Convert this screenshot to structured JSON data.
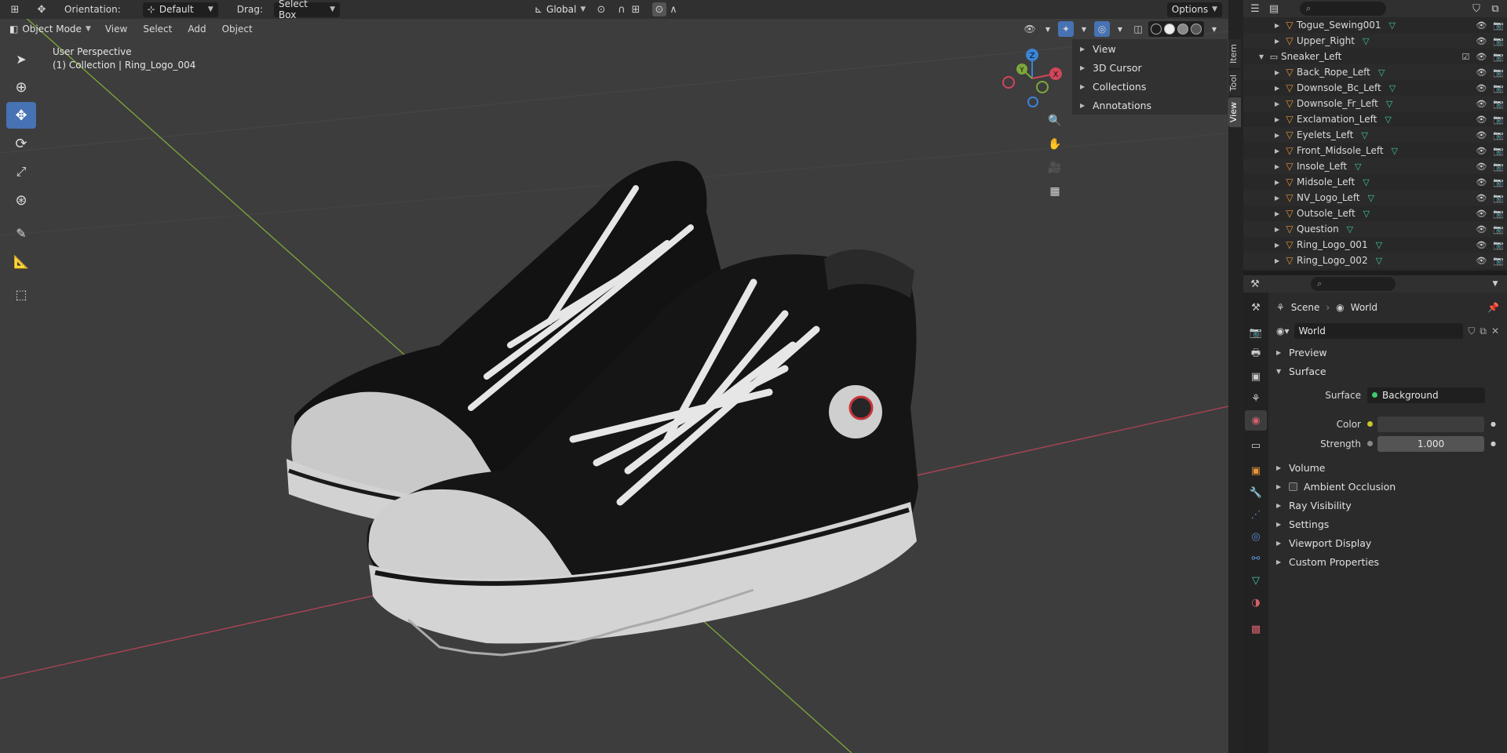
{
  "header": {
    "orientation_label": "Orientation:",
    "orientation_value": "Default",
    "drag_label": "Drag:",
    "drag_value": "Select Box",
    "transform_space": "Global",
    "options_label": "Options"
  },
  "mode_header": {
    "mode": "Object Mode",
    "menus": [
      "View",
      "Select",
      "Add",
      "Object"
    ]
  },
  "viewport_info": {
    "perspective": "User Perspective",
    "collection": "(1) Collection | Ring_Logo_004"
  },
  "toolbar": {
    "tools": [
      "select-box",
      "cursor",
      "move",
      "rotate",
      "scale",
      "transform",
      "annotate",
      "measure",
      "add-cube"
    ],
    "active": "move"
  },
  "gizmo": {
    "x": "X",
    "y": "Y",
    "z": "Z"
  },
  "npanel": {
    "sections": [
      "View",
      "3D Cursor",
      "Collections",
      "Annotations"
    ],
    "tabs": [
      "Item",
      "Tool",
      "View"
    ],
    "active_tab": "View"
  },
  "outliner": {
    "rows": [
      {
        "label": "Togue_Sewing001",
        "type": "mesh",
        "indent": 2
      },
      {
        "label": "Upper_Right",
        "type": "mesh",
        "indent": 2
      },
      {
        "label": "Sneaker_Left",
        "type": "collection",
        "indent": 1
      },
      {
        "label": "Back_Rope_Left",
        "type": "mesh",
        "indent": 2
      },
      {
        "label": "Downsole_Bc_Left",
        "type": "mesh",
        "indent": 2
      },
      {
        "label": "Downsole_Fr_Left",
        "type": "mesh",
        "indent": 2
      },
      {
        "label": "Exclamation_Left",
        "type": "mesh",
        "indent": 2
      },
      {
        "label": "Eyelets_Left",
        "type": "mesh",
        "indent": 2
      },
      {
        "label": "Front_Midsole_Left",
        "type": "mesh",
        "indent": 2
      },
      {
        "label": "Insole_Left",
        "type": "mesh",
        "indent": 2
      },
      {
        "label": "Midsole_Left",
        "type": "mesh",
        "indent": 2
      },
      {
        "label": "NV_Logo_Left",
        "type": "mesh",
        "indent": 2
      },
      {
        "label": "Outsole_Left",
        "type": "mesh",
        "indent": 2
      },
      {
        "label": "Question",
        "type": "mesh",
        "indent": 2
      },
      {
        "label": "Ring_Logo_001",
        "type": "mesh",
        "indent": 2
      },
      {
        "label": "Ring_Logo_002",
        "type": "mesh",
        "indent": 2
      }
    ]
  },
  "properties": {
    "breadcrumb_scene": "Scene",
    "breadcrumb_world": "World",
    "world_name": "World",
    "panels": {
      "preview": "Preview",
      "surface": "Surface",
      "volume": "Volume",
      "ambient_occlusion": "Ambient Occlusion",
      "ray_visibility": "Ray Visibility",
      "settings": "Settings",
      "viewport_display": "Viewport Display",
      "custom_properties": "Custom Properties"
    },
    "surface_label": "Surface",
    "surface_value": "Background",
    "color_label": "Color",
    "strength_label": "Strength",
    "strength_value": "1.000"
  },
  "colors": {
    "accent": "#4772b3",
    "mesh_icon": "#e8953a",
    "mesh_data": "#41c7a8",
    "x_axis": "#d2455a",
    "y_axis": "#7ea83c",
    "z_axis": "#3a84d8"
  }
}
